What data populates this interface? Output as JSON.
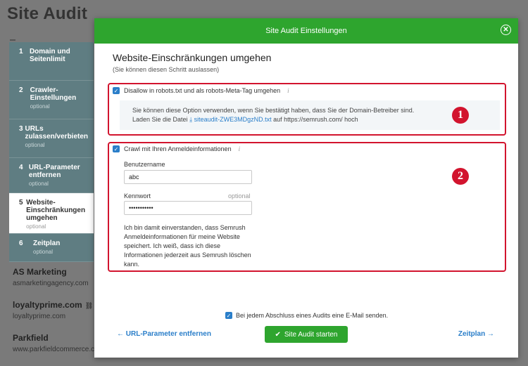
{
  "background": {
    "title": "Site Audit",
    "projects": [
      {
        "name": "AS Marketing",
        "url": "asmarketingagency.com",
        "link": ""
      },
      {
        "name": "loyaltyprime.com",
        "url": "loyaltyprime.com",
        "link": "⛓"
      },
      {
        "name": "Parkfield",
        "url": "www.parkfieldcommerce.co",
        "link": ""
      }
    ]
  },
  "steps": [
    {
      "num": "1",
      "label": "Domain und Seitenlimit",
      "opt": ""
    },
    {
      "num": "2",
      "label": "Crawler-Einstellungen",
      "opt": "optional"
    },
    {
      "num": "3",
      "label": "URLs zulassen/verbieten",
      "opt": "optional"
    },
    {
      "num": "4",
      "label": "URL-Parameter entfernen",
      "opt": "optional"
    },
    {
      "num": "5",
      "label": "Website-Einschränkungen umgehen",
      "opt": "optional"
    },
    {
      "num": "6",
      "label": "Zeitplan",
      "opt": "optional"
    }
  ],
  "modal": {
    "title": "Site Audit Einstellungen",
    "close": "✕",
    "heading": "Website-Einschränkungen umgehen",
    "subheading": "(Sie können diesen Schritt auslassen)",
    "disallow": {
      "label": "Disallow in robots.txt und als robots-Meta-Tag umgehen",
      "info_line1": "Sie können diese Option verwenden, wenn Sie bestätigt haben, dass Sie der Domain-Betreiber sind.",
      "info_pre": "Laden Sie die Datei",
      "file": "siteaudit-ZWE3MDgzND.txt",
      "info_post": "auf https://semrush.com/ hoch"
    },
    "crawl": {
      "label": "Crawl mit Ihren Anmeldeinformationen",
      "username_label": "Benutzername",
      "username_value": "abc",
      "password_label": "Kennwort",
      "password_optional": "optional",
      "password_value": "•••••••••••",
      "consent": "Ich bin damit einverstanden, dass Semrush Anmeldeinformationen für meine Website speichert. Ich weiß, dass ich diese Informationen jederzeit aus Semrush löschen kann."
    },
    "markers": [
      "1",
      "2"
    ],
    "email_label": "Bei jedem Abschluss eines Audits eine E-Mail senden.",
    "back_label": "URL-Parameter entfernen",
    "start_label": "Site Audit starten",
    "next_label": "Zeitplan"
  },
  "colors": {
    "accent_green": "#2ea52e",
    "link_blue": "#2a7ec9",
    "annotation_red": "#d2142e"
  }
}
